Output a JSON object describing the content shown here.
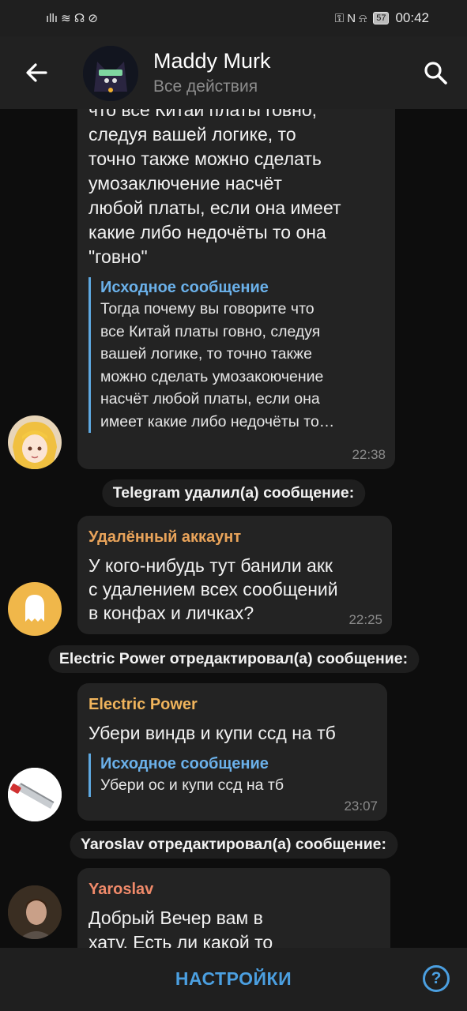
{
  "status_bar": {
    "signal_icons": "ıllı ≋ ☊ ⊘",
    "right_icons": "⚿ N ⍾",
    "battery": "57",
    "time": "00:42"
  },
  "header": {
    "title": "Maddy Murk",
    "subtitle": "Все действия"
  },
  "messages": [
    {
      "text": "что все Китай платы говно,\nследуя вашей логике, то\nточно также можно сделать\nумозаключение насчёт\nлюбой платы, если она имеет\nкакие либо недочёты то она\n\"говно\"",
      "quote_title": "Исходное сообщение",
      "quote_text": "Тогда почему вы говорите что\nвсе Китай платы говно, следуя\nвашей логике, то точно также\nможно сделать умозакоючение\nнасчёт любой платы, если она\nимеет какие либо недочёты то…",
      "time": "22:38"
    },
    {
      "service": "Telegram удалил(а) сообщение:",
      "sender": "Удалённый аккаунт",
      "sender_color": "#e8a35a",
      "text": "У кого-нибудь тут банили акк\nс удалением всех сообщений\nв конфах и личках?",
      "time": "22:25"
    },
    {
      "service": "Electric Power отредактировал(а) сообщение:",
      "sender": "Electric Power",
      "sender_color": "#f0b45c",
      "text": "Убери виндв и купи ссд на тб",
      "quote_title": "Исходное сообщение",
      "quote_text": "Убери ос и купи ссд на тб",
      "time": "23:07"
    },
    {
      "service": "Yaroslav отредактировал(а) сообщение:",
      "sender": "Yaroslav",
      "sender_color": "#f08a6a",
      "text": "Добрый Вечер вам в\nхату. Есть ли какой то"
    }
  ],
  "bottom_bar": {
    "settings_label": "НАСТРОЙКИ",
    "help_label": "?"
  },
  "colors": {
    "accent": "#4b9fe0",
    "quote_accent": "#6bb1ea",
    "bubble": "#232323",
    "background": "#0d0d0d"
  },
  "icons": {
    "back": "arrow-left-icon",
    "search": "search-icon",
    "help": "question-circle-icon"
  }
}
